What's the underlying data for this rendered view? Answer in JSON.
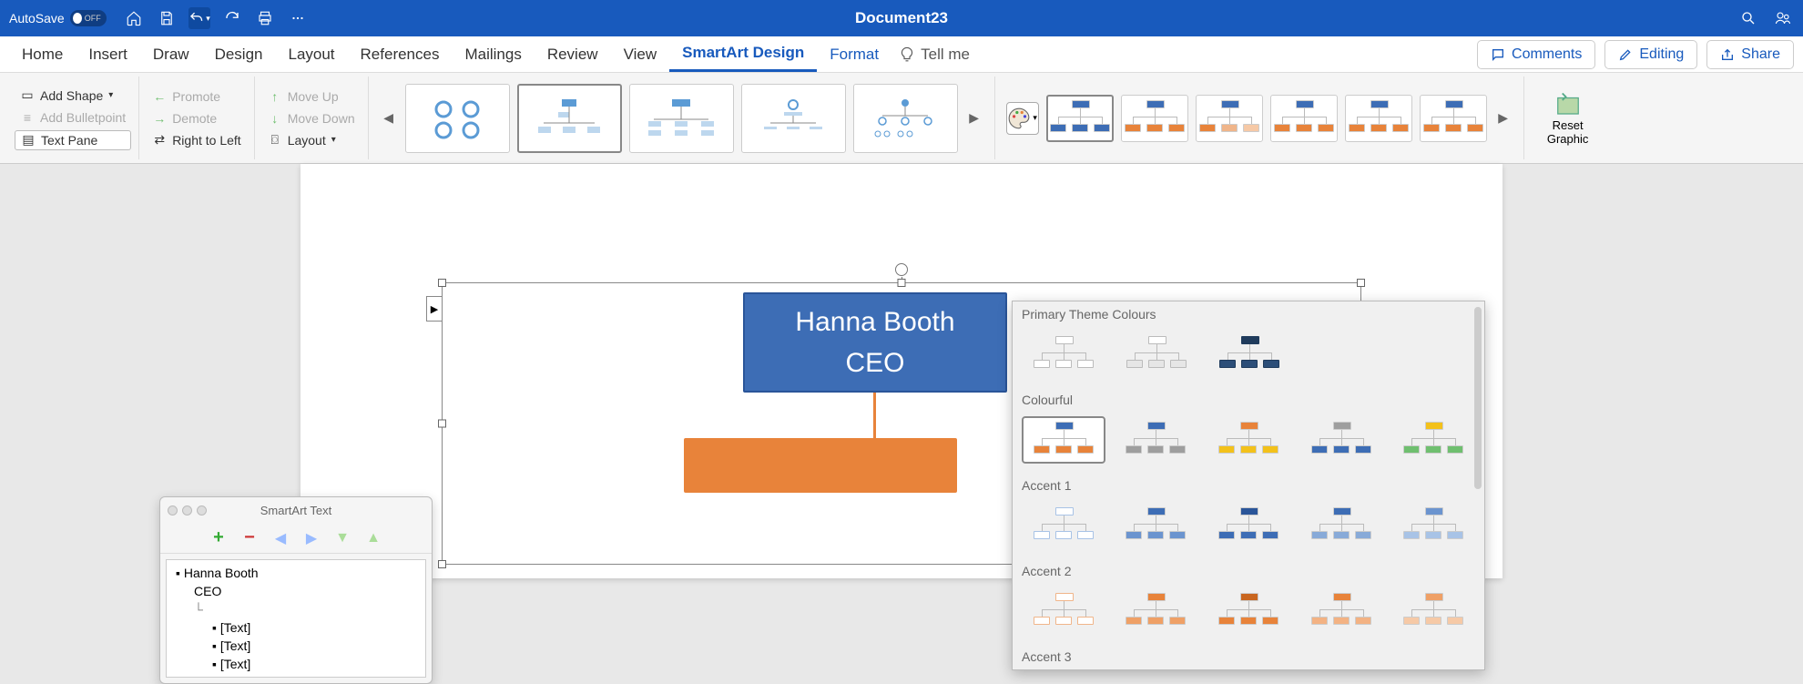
{
  "titlebar": {
    "autosave_label": "AutoSave",
    "autosave_state": "OFF",
    "document_title": "Document23"
  },
  "tabs": {
    "home": "Home",
    "insert": "Insert",
    "draw": "Draw",
    "design": "Design",
    "layout": "Layout",
    "references": "References",
    "mailings": "Mailings",
    "review": "Review",
    "view": "View",
    "smartart_design": "SmartArt Design",
    "format": "Format",
    "tell_me": "Tell me"
  },
  "ribbon_right": {
    "comments": "Comments",
    "editing": "Editing",
    "share": "Share"
  },
  "ribbon": {
    "add_shape": "Add Shape",
    "add_bulletpoint": "Add Bulletpoint",
    "text_pane": "Text Pane",
    "promote": "Promote",
    "demote": "Demote",
    "right_to_left": "Right to Left",
    "move_up": "Move Up",
    "move_down": "Move Down",
    "layout": "Layout",
    "reset_graphic": "Reset Graphic"
  },
  "smartart_content": {
    "node1_line1": "Hanna Booth",
    "node1_line2": "CEO"
  },
  "text_pane": {
    "title": "SmartArt Text",
    "items": [
      {
        "level": 0,
        "text": "Hanna Booth"
      },
      {
        "level": 1,
        "text": "CEO",
        "nobullet": true
      },
      {
        "level": 1,
        "text": "",
        "connector": true
      },
      {
        "level": 2,
        "text": "[Text]"
      },
      {
        "level": 2,
        "text": "[Text]"
      },
      {
        "level": 2,
        "text": "[Text]"
      }
    ]
  },
  "color_dropdown": {
    "sections": {
      "primary": "Primary Theme Colours",
      "colourful": "Colourful",
      "accent1": "Accent 1",
      "accent2": "Accent 2",
      "accent3": "Accent 3"
    },
    "primary_row": [
      {
        "top": "#ffffff",
        "bottom": "#ffffff",
        "outline": "#bbb"
      },
      {
        "top": "#ffffff",
        "bottom": "#e6e6e6",
        "outline": "#bbb"
      },
      {
        "top": "#1f3b5c",
        "bottom": "#2c4e78",
        "outline": "#1f3b5c"
      }
    ],
    "colourful_row": [
      {
        "top": "#3d6db5",
        "b1": "#e8833a",
        "b2": "#e8833a",
        "b3": "#e8833a",
        "selected": true
      },
      {
        "top": "#3d6db5",
        "b1": "#9e9e9e",
        "b2": "#9e9e9e",
        "b3": "#9e9e9e"
      },
      {
        "top": "#e8833a",
        "b1": "#f3c11a",
        "b2": "#f3c11a",
        "b3": "#f3c11a"
      },
      {
        "top": "#9e9e9e",
        "b1": "#3d6db5",
        "b2": "#3d6db5",
        "b3": "#3d6db5"
      },
      {
        "top": "#f3c11a",
        "b1": "#6fbf6f",
        "b2": "#6fbf6f",
        "b3": "#6fbf6f"
      }
    ],
    "accent1_row": [
      {
        "top": "#ffffff",
        "bottom": "#ffffff",
        "outline": "#a8c3e6"
      },
      {
        "top": "#3d6db5",
        "bottom": "#6b94cf"
      },
      {
        "top": "#2a5599",
        "bottom": "#3d6db5"
      },
      {
        "top": "#3d6db5",
        "bottom": "#88aad8"
      },
      {
        "top": "#6b94cf",
        "bottom": "#a8c3e6"
      }
    ],
    "accent2_row": [
      {
        "top": "#ffffff",
        "bottom": "#ffffff",
        "outline": "#f0b58a"
      },
      {
        "top": "#e8833a",
        "bottom": "#efa066"
      },
      {
        "top": "#c96620",
        "bottom": "#e8833a"
      },
      {
        "top": "#e8833a",
        "bottom": "#f3b283"
      },
      {
        "top": "#efa066",
        "bottom": "#f6c9a6"
      }
    ]
  },
  "color_strip": [
    {
      "top": "#3d6db5",
      "bottom": "#3d6db5",
      "selected": true
    },
    {
      "top": "#3d6db5",
      "b1": "#e8833a",
      "b2": "#e8833a",
      "b3": "#e8833a"
    },
    {
      "top": "#3d6db5",
      "b1": "#e8833a",
      "b2": "#f0b58a",
      "b3": "#f6c9a6"
    },
    {
      "top": "#3d6db5",
      "b1": "#e8833a",
      "b2": "#e8833a",
      "b3": "#e8833a"
    },
    {
      "top": "#3d6db5",
      "b1": "#e8833a",
      "b2": "#e8833a",
      "b3": "#e8833a"
    },
    {
      "top": "#3d6db5",
      "b1": "#e8833a",
      "b2": "#e8833a",
      "b3": "#e8833a"
    }
  ]
}
